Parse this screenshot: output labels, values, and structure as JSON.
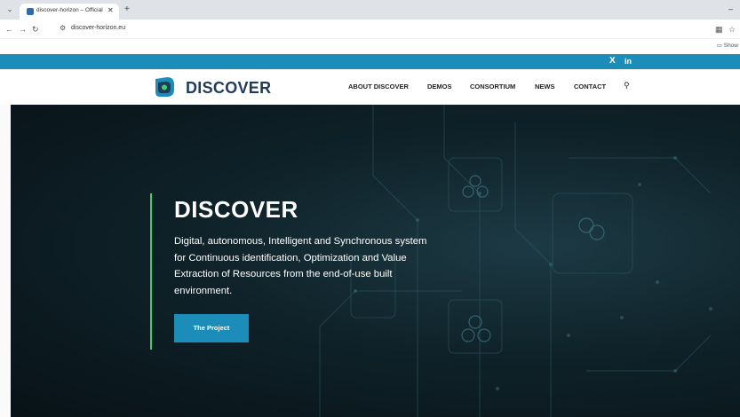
{
  "browser": {
    "tab_title": "discover-horizon – Official Proj",
    "url": "discover-horizon.eu",
    "bookmark_label": "Show"
  },
  "social": {
    "x_label": "X",
    "in_label": "in"
  },
  "nav": {
    "logo_text": "DISCOVER",
    "items": [
      {
        "label": "ABOUT DISCOVER"
      },
      {
        "label": "DEMOS"
      },
      {
        "label": "CONSORTIUM"
      },
      {
        "label": "NEWS"
      },
      {
        "label": "CONTACT"
      }
    ]
  },
  "hero": {
    "title": "DISCOVER",
    "description": "Digital, autonomous, Intelligent and Synchronous system for Continuous identification, Optimization and Value Extraction of Resources from the end-of-use built environment.",
    "button_label": "The Project"
  },
  "colors": {
    "accent": "#1c8db8",
    "line": "#3fcf6d",
    "brand": "#1f3a5a"
  }
}
